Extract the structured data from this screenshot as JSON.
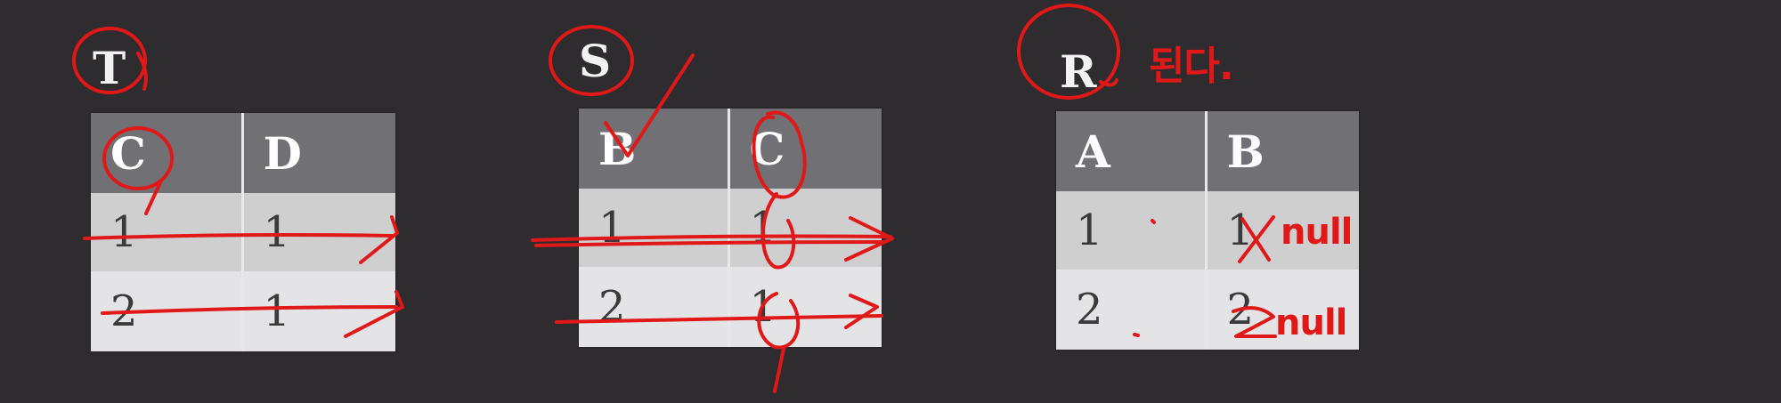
{
  "tables": {
    "T": {
      "name": "T",
      "columns": [
        "C",
        "D"
      ],
      "rows": [
        [
          "1",
          "1"
        ],
        [
          "2",
          "1"
        ]
      ]
    },
    "S": {
      "name": "S",
      "columns": [
        "B",
        "C"
      ],
      "rows": [
        [
          "1",
          "1"
        ],
        [
          "2",
          "1"
        ]
      ]
    },
    "R": {
      "name": "R",
      "columns": [
        "A",
        "B"
      ],
      "rows": [
        [
          "1",
          "1"
        ],
        [
          "2",
          "2"
        ]
      ]
    }
  },
  "annotations": {
    "note_near_R": "된다.",
    "null_1": "null",
    "null_2": "null"
  },
  "colors": {
    "background": "#2f2c30",
    "header": "#707075",
    "row_dark": "#cfcfd0",
    "row_light": "#e4e4e6",
    "pen": "#e01818"
  }
}
